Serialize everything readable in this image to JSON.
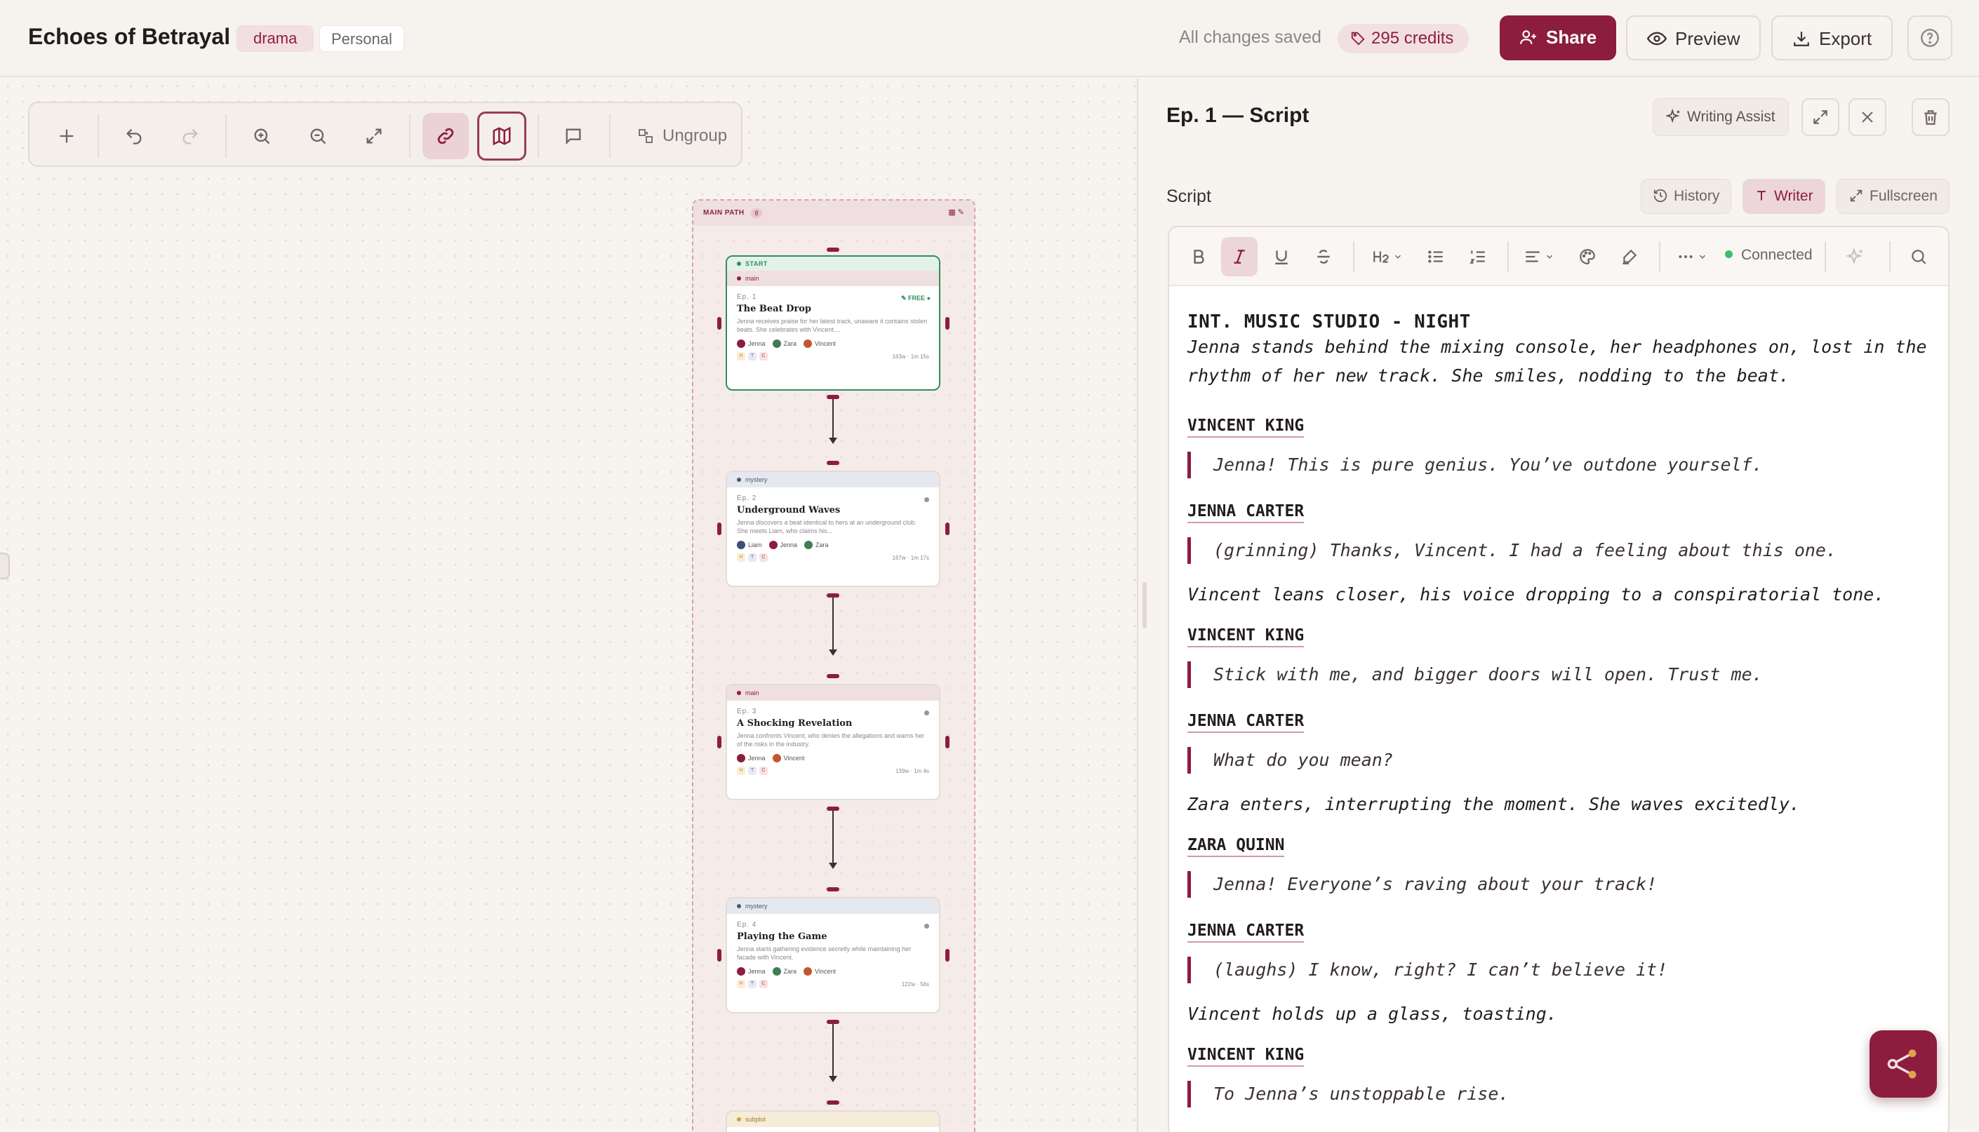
{
  "header": {
    "title": "Echoes of Betrayal",
    "genre_tag": "drama",
    "visibility_tag": "Personal",
    "save_status": "All changes saved",
    "credits": "295 credits",
    "share_label": "Share",
    "preview_label": "Preview",
    "export_label": "Export"
  },
  "toolbar": {
    "ungroup_label": "Ungroup"
  },
  "group": {
    "label": "MAIN PATH",
    "count": "8"
  },
  "episodes": [
    {
      "start_label": "START",
      "category": "main",
      "ep": "Ep. 1",
      "free_label": "FREE",
      "title": "The Beat Drop",
      "description": "Jenna receives praise for her latest track, unaware it contains stolen beats. She celebrates with Vincent,...",
      "characters": [
        "Jenna",
        "Zara",
        "Vincent"
      ],
      "stats": "163w · 1m 15s"
    },
    {
      "category": "mystery",
      "ep": "Ep. 2",
      "title": "Underground Waves",
      "description": "Jenna discovers a beat identical to hers at an underground club. She meets Liam, who claims his...",
      "characters": [
        "Liam",
        "Jenna",
        "Zara"
      ],
      "stats": "167w · 1m 17s"
    },
    {
      "category": "main",
      "ep": "Ep. 3",
      "title": "A Shocking Revelation",
      "description": "Jenna confronts Vincent, who denies the allegations and warns her of the risks in the industry.",
      "characters": [
        "Jenna",
        "Vincent"
      ],
      "stats": "139w · 1m 4s"
    },
    {
      "category": "mystery",
      "ep": "Ep. 4",
      "title": "Playing the Game",
      "description": "Jenna starts gathering evidence secretly while maintaining her facade with Vincent.",
      "characters": [
        "Jenna",
        "Zara",
        "Vincent"
      ],
      "stats": "122w · 56s"
    },
    {
      "category": "subplot"
    }
  ],
  "badges": [
    "H",
    "T",
    "C"
  ],
  "panel": {
    "title": "Ep. 1 — Script",
    "writing_assist_label": "Writing Assist",
    "section_label": "Script",
    "history_label": "History",
    "writer_label": "Writer",
    "fullscreen_label": "Fullscreen",
    "connection_status": "Connected"
  },
  "script": [
    {
      "type": "heading",
      "text": "INT. MUSIC STUDIO - NIGHT"
    },
    {
      "type": "action",
      "text": "Jenna stands behind the mixing console, her headphones on, lost in the rhythm of her new track. She smiles, nodding to the beat."
    },
    {
      "type": "character",
      "text": "VINCENT KING"
    },
    {
      "type": "dialogue",
      "text": "Jenna! This is pure genius. You’ve outdone yourself."
    },
    {
      "type": "character",
      "text": "JENNA CARTER"
    },
    {
      "type": "dialogue",
      "text": "(grinning) Thanks, Vincent. I had a feeling about this one."
    },
    {
      "type": "action",
      "text": "Vincent leans closer, his voice dropping to a conspiratorial tone."
    },
    {
      "type": "character",
      "text": "VINCENT KING"
    },
    {
      "type": "dialogue",
      "text": "Stick with me, and bigger doors will open. Trust me."
    },
    {
      "type": "character",
      "text": "JENNA CARTER"
    },
    {
      "type": "dialogue",
      "text": "What do you mean?"
    },
    {
      "type": "action",
      "text": "Zara enters, interrupting the moment. She waves excitedly."
    },
    {
      "type": "character",
      "text": "ZARA QUINN"
    },
    {
      "type": "dialogue",
      "text": "Jenna! Everyone’s raving about your track!"
    },
    {
      "type": "character",
      "text": "JENNA CARTER"
    },
    {
      "type": "dialogue",
      "text": "(laughs) I know, right? I can’t believe it!"
    },
    {
      "type": "action",
      "text": "Vincent holds up a glass, toasting."
    },
    {
      "type": "character",
      "text": "VINCENT KING"
    },
    {
      "type": "dialogue",
      "text": "To Jenna’s unstoppable rise."
    }
  ],
  "colors": {
    "brand": "#8c1d3e",
    "background": "#f7f3ee",
    "start_green": "#2f8f5b",
    "connected_dot": "#3bbf6b"
  }
}
